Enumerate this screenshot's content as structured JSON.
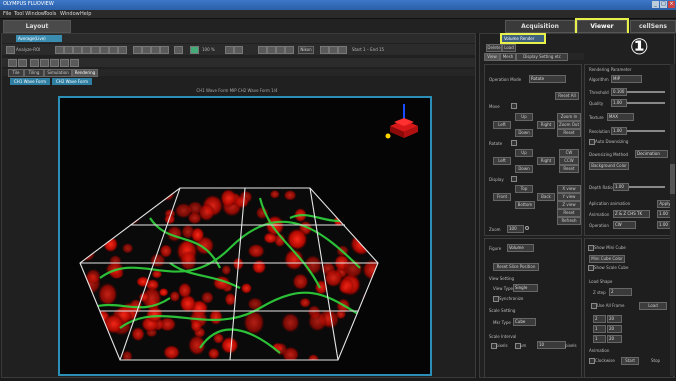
{
  "titlebar": {
    "title": "OLYMPUS FLUOVIEW"
  },
  "menu": {
    "items": [
      "File",
      "Tool Window",
      "Tools",
      "Window",
      "Help"
    ]
  },
  "tabs": {
    "layout": "Layout",
    "acquisition": "Acquisition",
    "viewer": "Viewer",
    "cellSens": "cellSens"
  },
  "annotation": {
    "marker": "①"
  },
  "left": {
    "image_tab": "Average(Live)",
    "analyze_label": "Analyze-ROI",
    "zoom_value": "100 %",
    "mode_label": "Nikon",
    "frame_label": "Start 1 – End 15",
    "subtabs": [
      "Tile",
      "Tiling",
      "Simulation",
      "Rendering"
    ],
    "image_tabs": [
      "CH1 Wave Form",
      "CH2 Wave Form"
    ],
    "caption": "CH1 Wave Form MIP CH2 Wave Form 1/4"
  },
  "right": {
    "view_dropdown": "Volume Render",
    "top_tabs": [
      "Delete",
      "Load"
    ],
    "section_tabs": [
      "View",
      "Mesh",
      "Display Setting etc"
    ],
    "operation_mode_label": "Operation Mode",
    "operation_mode_value": "Rotate",
    "reset_all": "Reset All",
    "move_label": "Move",
    "up": "Up",
    "left": "Left",
    "right": "Right",
    "down": "Down",
    "zoom_in": "Zoom In",
    "zoom_out": "Zoom Out",
    "reset": "Reset",
    "rotate_label": "Rotate",
    "cw": "CW",
    "ccw": "CCW",
    "display_label": "Display",
    "front": "Front",
    "back": "Back",
    "top": "Top",
    "bottom": "Bottom",
    "x_view": "X view",
    "y_view": "Y view",
    "z_view": "Z view",
    "reset_rot": "Reset",
    "refresh": "Refresh",
    "zoom_label": "Zoom",
    "zoom_value": "100",
    "figure_label": "Figure",
    "figure_value": "Volume",
    "reset_start": "Reset Slice Position",
    "view_setting": "View Setting",
    "view_type_label": "View Type",
    "view_type_value": "Single",
    "synchronize": "Synchronize",
    "scale_setting": "Scale Setting",
    "mkr_type_label": "Mkr Type",
    "mkr_type_value": "Cube",
    "scale_interval": "Scale Interval",
    "pixels_label": "pixels",
    "um_label": "um",
    "pixels_value": "10",
    "pixels_suffix": "pixels",
    "rendering_param": "Rendering Parameter",
    "algorithm_label": "Algorithm",
    "algorithm_value": "MIP",
    "threshold_label": "Threshold",
    "threshold_value": "0.100",
    "quality_label": "Quality",
    "quality_value": "1.00",
    "texture_label": "Texture",
    "texture_value": "MAX",
    "resolution_label": "Resolution",
    "resolution_value": "1.00",
    "auto_downsizing": "Auto Downsizing",
    "downsizing_label": "Downsizing Method",
    "downsizing_value": "Decimation",
    "background_color": "Background Color",
    "depth_ratio_label": "Depth Ratio",
    "depth_ratio_value": "1.00",
    "aplication_label": "Aplication animation",
    "apply_btn": "Apply",
    "animation_label": "Animation",
    "animation_value": "Z & Z CHS TK",
    "operation_label": "Operation",
    "operation_value": "CW",
    "anim_val": "1.00",
    "show_mini_cube": "Show Mini Cube",
    "mini_cube_color": "Mini Cube Color",
    "show_scale_cube": "Show Scale Cube",
    "load_shape": "Load Shape",
    "z_step_label": "Z step",
    "z_step_value": "2",
    "use_all_frame": "Use All Frame",
    "load_btn": "Load",
    "x_label": "Axis",
    "axis_rows": [
      "2",
      "1",
      "1"
    ],
    "axis_vals": [
      "20",
      "20",
      "20"
    ],
    "animation2": "Animation",
    "clockwise": "Clockwise",
    "start_btn": "Start",
    "stop_btn": "Stop"
  }
}
